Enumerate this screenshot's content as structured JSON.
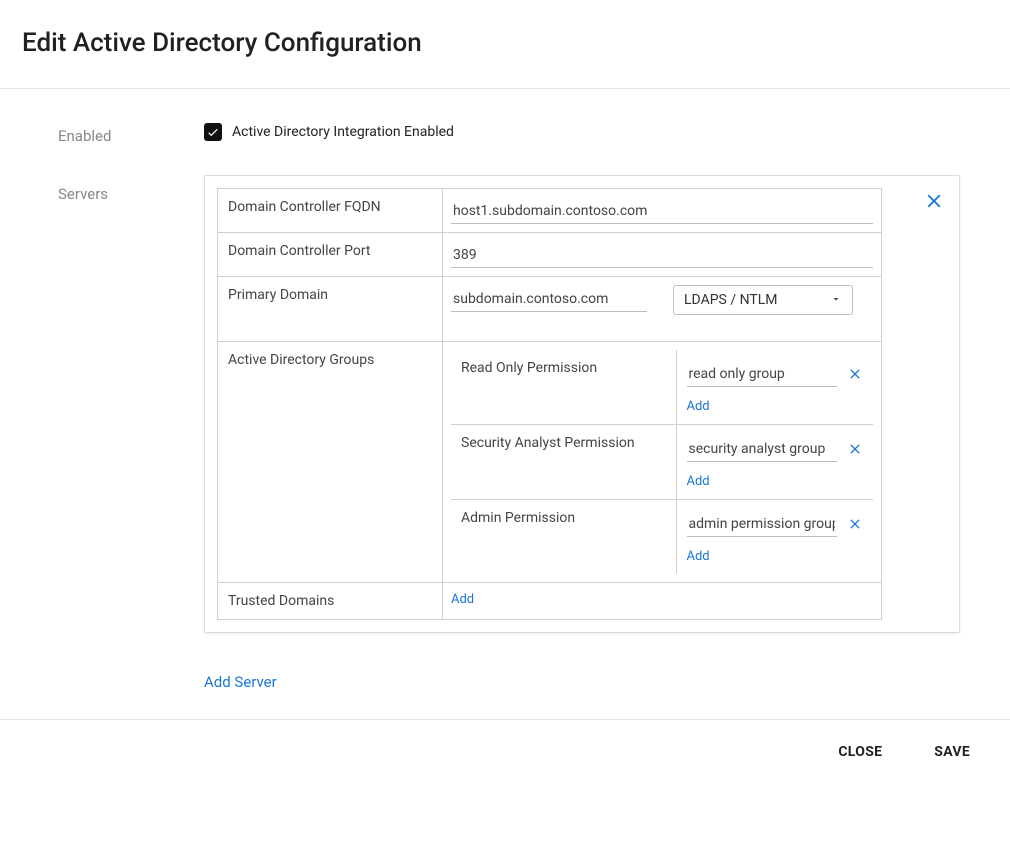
{
  "title": "Edit Active Directory Configuration",
  "labels": {
    "enabled": "Enabled",
    "servers": "Servers",
    "checkbox_label": "Active Directory Integration Enabled",
    "fqdn": "Domain Controller FQDN",
    "port": "Domain Controller Port",
    "primary_domain": "Primary Domain",
    "ad_groups": "Active Directory Groups",
    "trusted_domains": "Trusted Domains",
    "add": "Add",
    "add_server": "Add Server",
    "close": "CLOSE",
    "save": "SAVE"
  },
  "server": {
    "fqdn": "host1.subdomain.contoso.com",
    "port": "389",
    "primary_domain": "subdomain.contoso.com",
    "auth_mode": "LDAPS / NTLM"
  },
  "groups": [
    {
      "permission": "Read Only Permission",
      "group": "read only group"
    },
    {
      "permission": "Security Analyst Permission",
      "group": "security analyst group"
    },
    {
      "permission": "Admin Permission",
      "group": "admin permission group"
    }
  ],
  "enabled": true
}
